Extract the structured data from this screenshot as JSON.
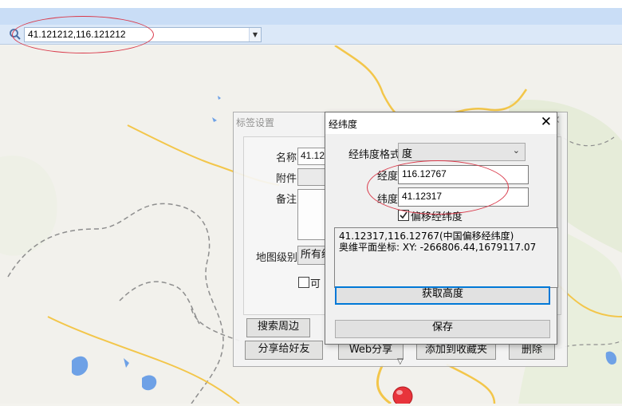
{
  "search": {
    "value": "41.121212,116.121212"
  },
  "back_dialog": {
    "title": "标签设置",
    "name_label": "名称",
    "name_value": "41.12",
    "attachment_label": "附件",
    "notes_label": "备注",
    "map_level_label": "地图级别",
    "map_level_value": "所有级",
    "checkbox_partial_label": "可",
    "search_nearby_button": "搜索周边",
    "share_friends_button": "分享给好友",
    "web_share_button": "Web分享",
    "add_favorites_button": "添加到收藏夹",
    "delete_button": "删除",
    "expand_glyph": "▽"
  },
  "dialog": {
    "title": "经纬度",
    "close_glyph": "✕",
    "format_label": "经纬度格式",
    "format_value": "度",
    "lon_label": "经度",
    "lon_value": "116.12767",
    "lat_label": "纬度",
    "lat_value": "41.12317",
    "offset_checkbox_label": "偏移经纬度",
    "offset_checked": true,
    "info_line1": "41.12317,116.12767(中国偏移经纬度)",
    "info_line2": "奥维平面坐标: XY: -266806.44,1679117.07",
    "get_altitude_button": "获取高度",
    "save_button": "保存"
  },
  "colors": {
    "annotation": "#d9394a",
    "water": "#6ea1e6",
    "road": "#f3c64a",
    "boundary": "#8e8e8e",
    "marker": "#e8343b",
    "green_area": "#cfe3b8"
  }
}
